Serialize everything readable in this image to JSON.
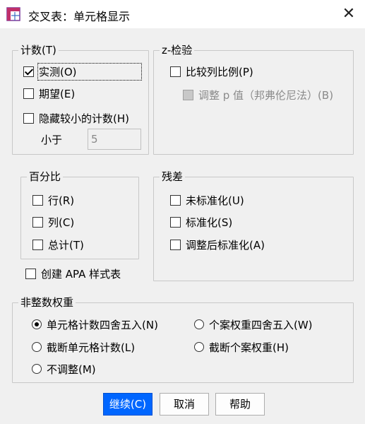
{
  "window": {
    "title": "交叉表：单元格显示",
    "close": "✕"
  },
  "counts": {
    "legend": "计数(T)",
    "observed": "实测(O)",
    "expected": "期望(E)",
    "hide_small": "隐藏较小的计数(H)",
    "less_than": "小于",
    "less_than_value": "5"
  },
  "z_test": {
    "legend": "z-检验",
    "compare": "比较列比例(P)",
    "adjust_p": "调整 p 值（邦弗伦尼法）(B)"
  },
  "percent": {
    "legend": "百分比",
    "row": "行(R)",
    "column": "列(C)",
    "total": "总计(T)"
  },
  "residuals": {
    "legend": "残差",
    "unstandardized": "未标准化(U)",
    "standardized": "标准化(S)",
    "adjusted": "调整后标准化(A)"
  },
  "apa": "创建 APA 样式表",
  "weights": {
    "legend": "非整数权重",
    "round_cell": "单元格计数四舍五入(N)",
    "round_case": "个案权重四舍五入(W)",
    "truncate_cell": "截断单元格计数(L)",
    "truncate_case": "截断个案权重(H)",
    "no_adjust": "不调整(M)"
  },
  "buttons": {
    "continue": "继续(C)",
    "cancel": "取消",
    "help": "帮助"
  },
  "colors": {
    "primary": "#0066ff",
    "background": "#f0f0f0"
  }
}
